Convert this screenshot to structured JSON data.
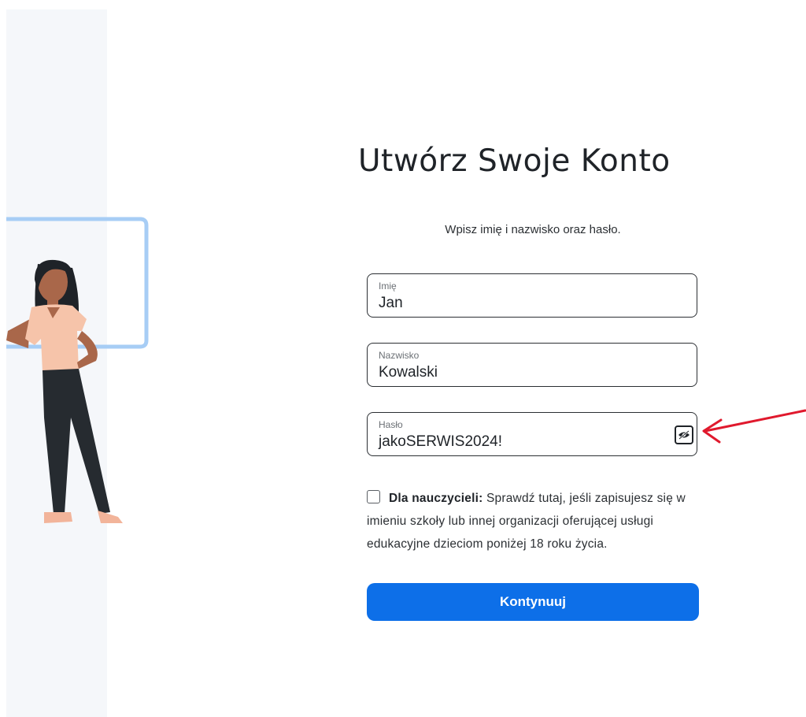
{
  "page": {
    "title": "Utwórz Swoje Konto",
    "subtitle": "Wpisz imię i nazwisko oraz hasło."
  },
  "form": {
    "first_name": {
      "label": "Imię",
      "value": "Jan"
    },
    "last_name": {
      "label": "Nazwisko",
      "value": "Kowalski"
    },
    "password": {
      "label": "Hasło",
      "value": "jakoSERWIS2024!",
      "toggle_icon": "eye-slash-icon"
    }
  },
  "teacher": {
    "checked": false,
    "label_bold": "Dla nauczycieli:",
    "label_rest": " Sprawdź tutaj, jeśli zapisujesz się w imieniu szkoły lub innej organizacji oferującej usługi edukacyjne dzieciom poniżej 18 roku życia."
  },
  "actions": {
    "continue_label": "Kontynuuj"
  },
  "annotation": {
    "arrow_color": "#e0192d"
  },
  "colors": {
    "primary": "#0d6fe8",
    "panel": "#f5f7fa",
    "illustration_frame": "#a7cdf5"
  }
}
